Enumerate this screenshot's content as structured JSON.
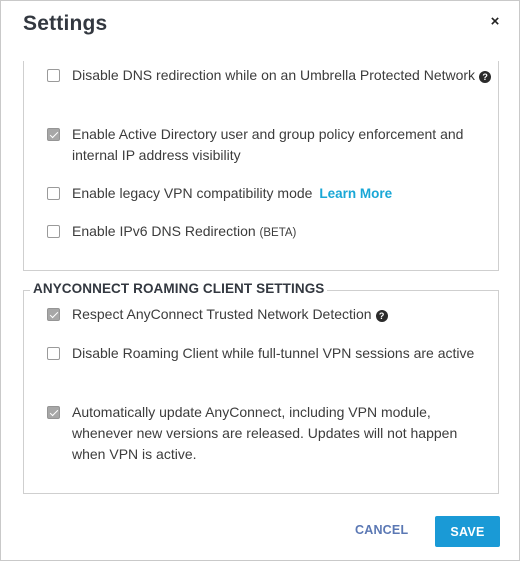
{
  "dialog": {
    "title": "Settings",
    "close_label": "×"
  },
  "general": {
    "options": [
      {
        "text": "Disable DNS redirection while on an Umbrella Protected Network",
        "checked": false,
        "help": "?"
      },
      {
        "text": "Enable Active Directory user and group policy enforcement and internal IP address visibility",
        "checked": true
      },
      {
        "text": "Enable legacy VPN compatibility mode",
        "link": "Learn More",
        "checked": false
      },
      {
        "text": "Enable IPv6 DNS Redirection",
        "suffix": "(BETA)",
        "checked": false
      }
    ]
  },
  "roaming": {
    "legend": "ANYCONNECT ROAMING CLIENT SETTINGS",
    "options": [
      {
        "text": "Respect AnyConnect Trusted Network Detection",
        "checked": true,
        "help": "?"
      },
      {
        "text": "Disable Roaming Client while full-tunnel VPN sessions are active",
        "checked": false
      },
      {
        "text": "Automatically update AnyConnect, including VPN module, whenever new versions are released. Updates will not happen when VPN is active.",
        "checked": true
      }
    ]
  },
  "footer": {
    "cancel_label": "CANCEL",
    "save_label": "SAVE"
  },
  "colors": {
    "link": "#19a7d6",
    "save_button": "#1a9ad6",
    "cancel_text": "#5b78b4",
    "checked_box": "#a7a7a7"
  }
}
